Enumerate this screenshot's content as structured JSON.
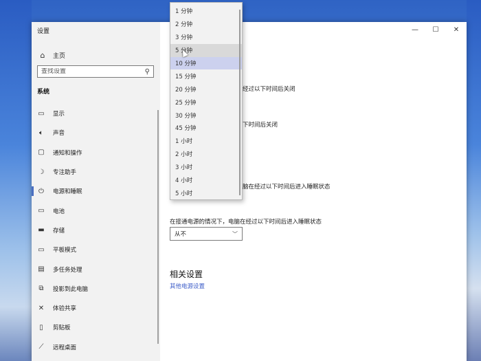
{
  "window": {
    "title": "设置",
    "controls": {
      "minimize": "—",
      "maximize": "☐",
      "close": "✕"
    }
  },
  "sidebar": {
    "home": {
      "icon": "home-icon",
      "label": "主页"
    },
    "search": {
      "placeholder": "查找设置",
      "icon": "search-icon"
    },
    "section_title": "系统",
    "items": [
      {
        "icon": "monitor-icon",
        "label": "显示"
      },
      {
        "icon": "speaker-icon",
        "label": "声音"
      },
      {
        "icon": "notification-icon",
        "label": "通知和操作"
      },
      {
        "icon": "moon-icon",
        "label": "专注助手"
      },
      {
        "icon": "power-icon",
        "label": "电源和睡眠",
        "active": true
      },
      {
        "icon": "battery-icon",
        "label": "电池"
      },
      {
        "icon": "storage-icon",
        "label": "存储"
      },
      {
        "icon": "tablet-icon",
        "label": "平板模式"
      },
      {
        "icon": "multitask-icon",
        "label": "多任务处理"
      },
      {
        "icon": "project-icon",
        "label": "投影到此电脑"
      },
      {
        "icon": "share-icon",
        "label": "体验共享"
      },
      {
        "icon": "clipboard-icon",
        "label": "剪贴板"
      },
      {
        "icon": "remote-icon",
        "label": "远程桌面"
      }
    ]
  },
  "main": {
    "frag_screen_battery": "经过以下时间后关闭",
    "frag_screen_plugged": "下时间后关闭",
    "frag_sleep_battery": "脑在经过以下时间后进入睡眠状态",
    "sleep_plugged_label": "在接通电源的情况下，电脑在经过以下时间后进入睡眠状态",
    "sleep_plugged_value": "从不",
    "related_title": "相关设置",
    "related_link": "其他电源设置"
  },
  "dropdown": {
    "options": [
      "1 分钟",
      "2 分钟",
      "3 分钟",
      "5 分钟",
      "10 分钟",
      "15 分钟",
      "20 分钟",
      "25 分钟",
      "30 分钟",
      "45 分钟",
      "1 小时",
      "2 小时",
      "3 小时",
      "4 小时",
      "5 小时"
    ],
    "hovered": "5 分钟",
    "selected": "10 分钟"
  },
  "colors": {
    "accent": "#4b6fc0",
    "link": "#3f5fc9",
    "selected_option": "#ccd1ee"
  }
}
